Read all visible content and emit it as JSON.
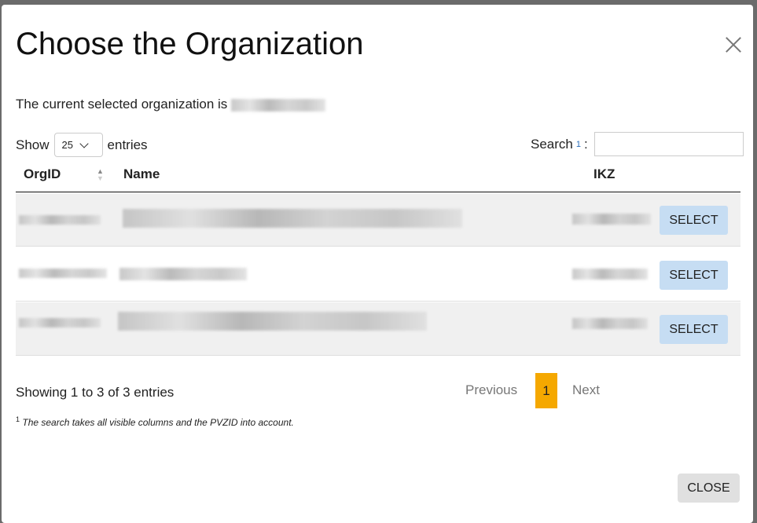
{
  "modal": {
    "title": "Choose the Organization",
    "current_text": "The current selected organization is"
  },
  "controls": {
    "show_label": "Show",
    "entries_value": "25",
    "entries_label": "entries",
    "search_label": "Search",
    "search_footnote_mark": "1",
    "search_colon": ":",
    "search_value": ""
  },
  "table": {
    "columns": [
      "OrgID",
      "Name",
      "IKZ"
    ],
    "select_label": "SELECT",
    "row_count": 3
  },
  "footer": {
    "info": "Showing 1 to 3 of 3 entries",
    "previous": "Previous",
    "page": "1",
    "next": "Next",
    "footnote_mark": "1",
    "footnote": "The search takes all visible columns and the PVZID into account.",
    "close": "CLOSE"
  },
  "colors": {
    "accent": "#f5a800",
    "select_button": "#c6ddf3"
  }
}
